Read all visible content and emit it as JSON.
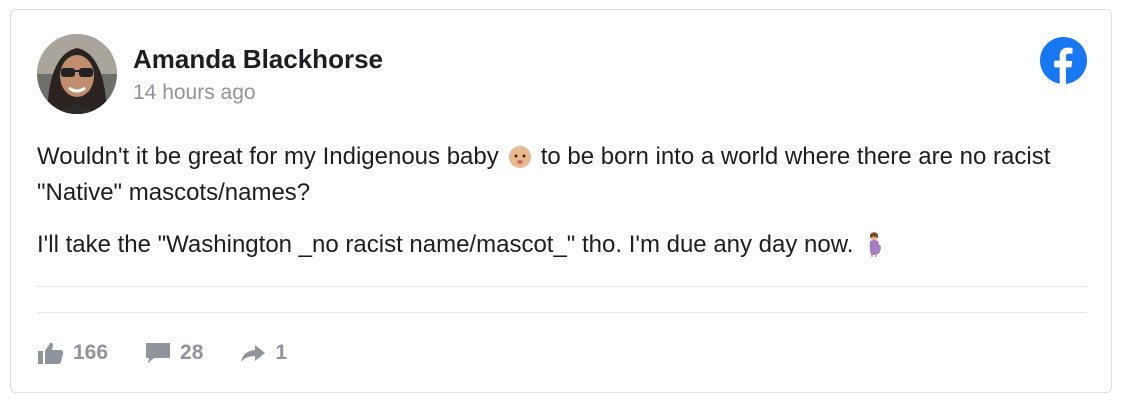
{
  "post": {
    "author": "Amanda Blackhorse",
    "timestamp": "14 hours ago",
    "paragraph1": {
      "before_emoji": "Wouldn't it be great for my Indigenous baby",
      "emoji": "baby-emoji",
      "after_emoji": "to be born into a world where there are no racist \"Native\" mascots/names?"
    },
    "paragraph2": {
      "text": "I'll take the \"Washington _no racist name/mascot_\" tho. I'm due any day now.",
      "emoji": "pregnant-woman-emoji"
    }
  },
  "stats": {
    "likes": "166",
    "comments": "28",
    "shares": "1"
  },
  "icons": {
    "brand": "facebook-logo-icon",
    "like": "thumbs-up-icon",
    "comment": "speech-bubble-icon",
    "share": "share-arrow-icon"
  },
  "colors": {
    "facebook_blue": "#1877f2",
    "meta_gray": "#90949c",
    "text": "#1c1e21",
    "border": "#dddfe2"
  }
}
